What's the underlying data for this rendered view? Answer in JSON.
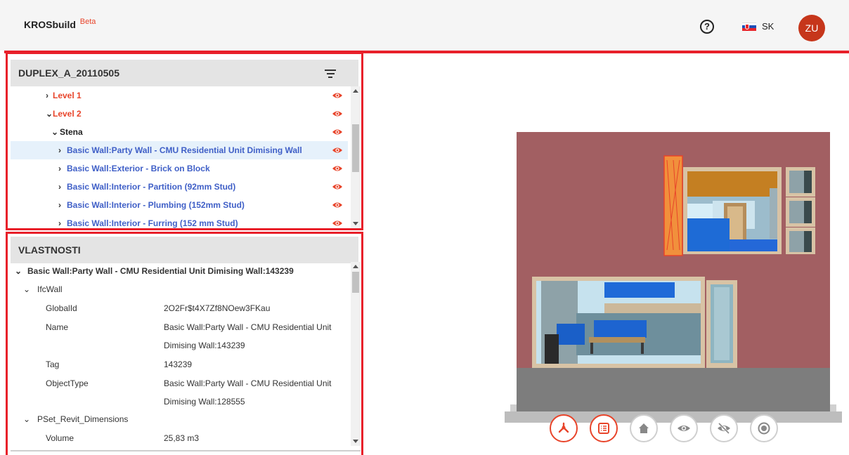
{
  "header": {
    "app_name": "KROSbuild",
    "beta_label": "Beta",
    "help_label": "?",
    "language": "SK",
    "avatar_initials": "ZU"
  },
  "tree": {
    "project_name": "DUPLEX_A_20110505",
    "rows": [
      {
        "label": "Level 1",
        "level": 0,
        "expanded": false,
        "color": "orange"
      },
      {
        "label": "Level 2",
        "level": 0,
        "expanded": true,
        "color": "orange"
      },
      {
        "label": "Stena",
        "level": 1,
        "expanded": true,
        "color": "black"
      },
      {
        "label": "Basic Wall:Party Wall - CMU Residential Unit Dimising Wall",
        "level": 2,
        "expanded": false,
        "color": "blue",
        "selected": true
      },
      {
        "label": "Basic Wall:Exterior - Brick on Block",
        "level": 2,
        "expanded": false,
        "color": "blue"
      },
      {
        "label": "Basic Wall:Interior - Partition (92mm Stud)",
        "level": 2,
        "expanded": false,
        "color": "blue"
      },
      {
        "label": "Basic Wall:Interior - Plumbing (152mm Stud)",
        "level": 2,
        "expanded": false,
        "color": "blue"
      },
      {
        "label": "Basic Wall:Interior - Furring (152 mm Stud)",
        "level": 2,
        "expanded": false,
        "color": "blue"
      }
    ]
  },
  "properties": {
    "title": "VLASTNOSTI",
    "element": "Basic Wall:Party Wall - CMU Residential Unit Dimising Wall:143239",
    "groups": [
      {
        "name": "IfcWall",
        "rows": [
          {
            "key": "GlobalId",
            "value": "2O2Fr$t4X7Zf8NOew3FKau"
          },
          {
            "key": "Name",
            "value": "Basic Wall:Party Wall - CMU Residential Unit",
            "value2": "Dimising Wall:143239"
          },
          {
            "key": "Tag",
            "value": "143239"
          },
          {
            "key": "ObjectType",
            "value": "Basic Wall:Party Wall - CMU Residential Unit",
            "value2": "Dimising Wall:128555"
          }
        ]
      },
      {
        "name": "PSet_Revit_Dimensions",
        "rows": [
          {
            "key": "Volume",
            "value": "25,83 m3"
          }
        ]
      }
    ]
  },
  "viewer": {
    "toolbar": [
      {
        "icon": "tree-icon",
        "active": true
      },
      {
        "icon": "properties-list-icon",
        "active": true
      },
      {
        "icon": "home-icon",
        "active": false
      },
      {
        "icon": "eye-icon",
        "active": false
      },
      {
        "icon": "eye-off-icon",
        "active": false
      },
      {
        "icon": "isolate-icon",
        "active": false
      }
    ]
  },
  "colors": {
    "accent": "#e8442a",
    "frame": "#e8202a",
    "tree_blue": "#3f5fc7",
    "selected_bg": "#e6f1fb",
    "wall": "#a25f62"
  }
}
